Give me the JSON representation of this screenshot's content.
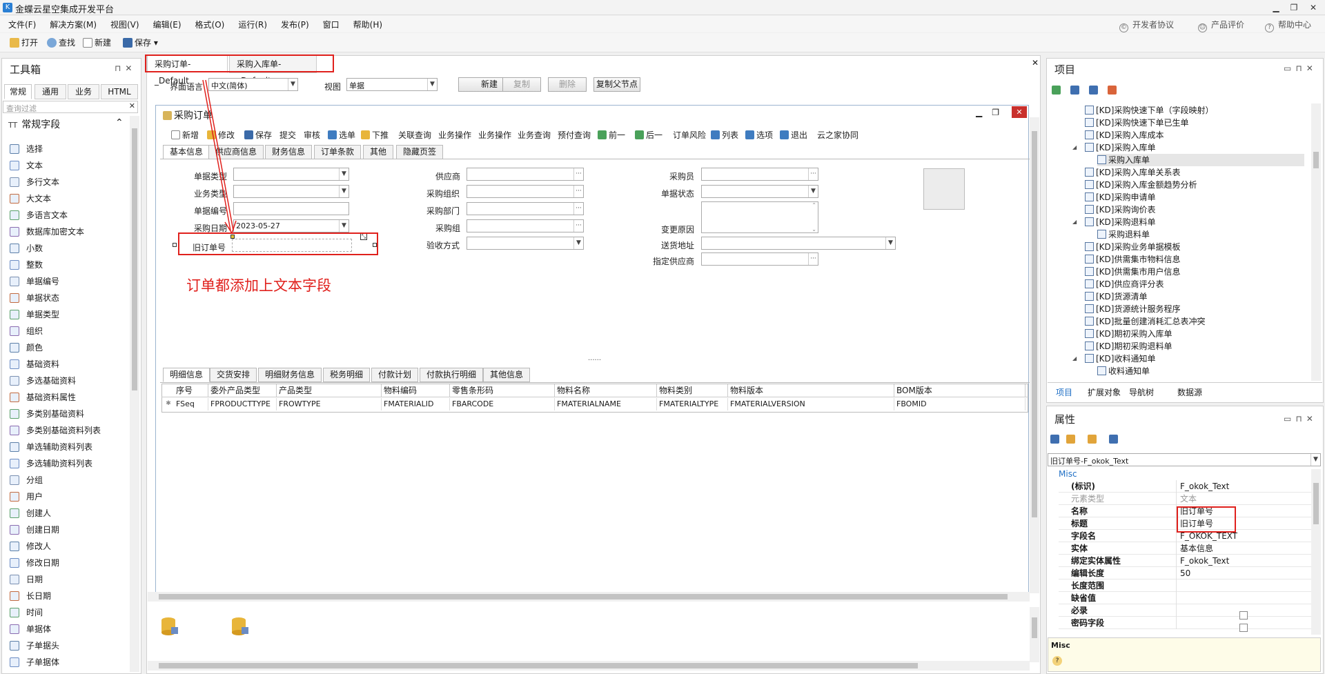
{
  "app": {
    "title": "金蝶云星空集成开发平台"
  },
  "menu": [
    "文件(F)",
    "解决方案(M)",
    "视图(V)",
    "编辑(E)",
    "格式(O)",
    "运行(R)",
    "发布(P)",
    "窗口",
    "帮助(H)"
  ],
  "top_links": {
    "dev_protocol": "开发者协议",
    "product_eval": "产品评价",
    "help": "帮助中心"
  },
  "toolbar": {
    "open": "打开",
    "find": "查找",
    "new": "新建",
    "save": "保存"
  },
  "toolbox": {
    "title": "工具箱",
    "tabs": [
      "常规",
      "通用",
      "业务",
      "HTML"
    ],
    "filter_placeholder": "查询过滤",
    "group": "常规字段",
    "items": [
      "选择",
      "文本",
      "多行文本",
      "大文本",
      "多语言文本",
      "数据库加密文本",
      "小数",
      "整数",
      "单据编号",
      "单据状态",
      "单据类型",
      "组织",
      "颜色",
      "基础资料",
      "多选基础资料",
      "基础资料属性",
      "多类别基础资料",
      "多类别基础资料列表",
      "单选辅助资料列表",
      "多选辅助资料列表",
      "分组",
      "用户",
      "创建人",
      "创建日期",
      "修改人",
      "修改日期",
      "日期",
      "长日期",
      "时间",
      "单据体",
      "子单据头",
      "子单据体"
    ]
  },
  "doc_tabs": [
    "采购订单-_Default",
    "采购入库单-_Default"
  ],
  "center_bar": {
    "ui_lang_label": "界面语言",
    "ui_lang_value": "中文(简体)",
    "view_label": "视图",
    "view_value": "单据",
    "new_btn": "新建",
    "copy_btn": "复制",
    "delete_btn": "删除",
    "copy_parent_btn": "复制父节点"
  },
  "form": {
    "title": "采购订单",
    "toolbar": [
      "新增",
      "修改",
      "保存",
      "提交",
      "审核",
      "选单",
      "下推",
      "关联查询",
      "业务操作",
      "业务操作",
      "业务查询",
      "预付查询",
      "前一",
      "后一",
      "订单风险",
      "列表",
      "选项",
      "退出",
      "云之家协同"
    ],
    "tabs": [
      "基本信息",
      "供应商信息",
      "财务信息",
      "订单条款",
      "其他",
      "隐藏页签"
    ],
    "fields_left": [
      "单据类型",
      "业务类型",
      "单据编号",
      "采购日期"
    ],
    "date_value": "2023-05-27",
    "old_order_label": "旧订单号",
    "fields_mid": [
      "供应商",
      "采购组织",
      "采购部门",
      "采购组",
      "验收方式"
    ],
    "fields_right": [
      "采购员",
      "单据状态",
      "变更原因",
      "送货地址",
      "指定供应商"
    ],
    "splitter": "......",
    "entry_tabs": [
      "明细信息",
      "交货安排",
      "明细财务信息",
      "税务明细",
      "付款计划",
      "付款执行明细",
      "其他信息"
    ],
    "grid_headers": [
      "序号",
      "委外产品类型",
      "产品类型",
      "物料编码",
      "零售条形码",
      "物料名称",
      "物料类别",
      "物料版本",
      "BOM版本"
    ],
    "grid_row": [
      "FSeq",
      "FPRODUCTTYPE",
      "FROWTYPE",
      "FMATERIALID",
      "FBARCODE",
      "FMATERIALNAME",
      "FMATERIALTYPE",
      "FMATERIALVERSION",
      "FBOMID"
    ]
  },
  "annotation": "订单都添加上文本字段",
  "project": {
    "title": "项目",
    "items": [
      {
        "label": "[KD]采购快速下单（字段映射）",
        "level": 1
      },
      {
        "label": "[KD]采购快速下单已生单",
        "level": 1
      },
      {
        "label": "[KD]采购入库成本",
        "level": 1
      },
      {
        "label": "[KD]采购入库单",
        "level": 1,
        "expanded": true
      },
      {
        "label": "采购入库单",
        "level": 2,
        "selected": true
      },
      {
        "label": "[KD]采购入库单关系表",
        "level": 1
      },
      {
        "label": "[KD]采购入库金额趋势分析",
        "level": 1
      },
      {
        "label": "[KD]采购申请单",
        "level": 1
      },
      {
        "label": "[KD]采购询价表",
        "level": 1
      },
      {
        "label": "[KD]采购退料单",
        "level": 1,
        "expanded": true
      },
      {
        "label": "采购退料单",
        "level": 2
      },
      {
        "label": "[KD]采购业务单据模板",
        "level": 1
      },
      {
        "label": "[KD]供需集市物料信息",
        "level": 1
      },
      {
        "label": "[KD]供需集市用户信息",
        "level": 1
      },
      {
        "label": "[KD]供应商评分表",
        "level": 1
      },
      {
        "label": "[KD]货源清单",
        "level": 1
      },
      {
        "label": "[KD]货源统计服务程序",
        "level": 1
      },
      {
        "label": "[KD]批量创建消耗汇总表冲突",
        "level": 1
      },
      {
        "label": "[KD]期初采购入库单",
        "level": 1
      },
      {
        "label": "[KD]期初采购退料单",
        "level": 1
      },
      {
        "label": "[KD]收料通知单",
        "level": 1,
        "expanded": true
      },
      {
        "label": "收料通知单",
        "level": 2
      }
    ],
    "tabs": [
      "项目",
      "扩展对象",
      "导航树",
      "数据源"
    ]
  },
  "properties": {
    "title": "属性",
    "selector": "旧订单号-F_okok_Text",
    "category": "Misc",
    "rows": [
      {
        "k": "(标识)",
        "v": "F_okok_Text"
      },
      {
        "k": "元素类型",
        "v": "文本",
        "disabled": true
      },
      {
        "k": "名称",
        "v": "旧订单号"
      },
      {
        "k": "标题",
        "v": "旧订单号"
      },
      {
        "k": "字段名",
        "v": "F_OKOK_TEXT"
      },
      {
        "k": "实体",
        "v": "基本信息"
      },
      {
        "k": "绑定实体属性",
        "v": "F_okok_Text"
      },
      {
        "k": "编辑长度",
        "v": "50"
      },
      {
        "k": "长度范围",
        "v": ""
      },
      {
        "k": "缺省值",
        "v": ""
      },
      {
        "k": "必录",
        "v": ""
      },
      {
        "k": "密码字段",
        "v": ""
      }
    ],
    "footer_title": "Misc"
  },
  "colors": {
    "accent": "#2a7fd4",
    "annotation": "#e0201c"
  }
}
